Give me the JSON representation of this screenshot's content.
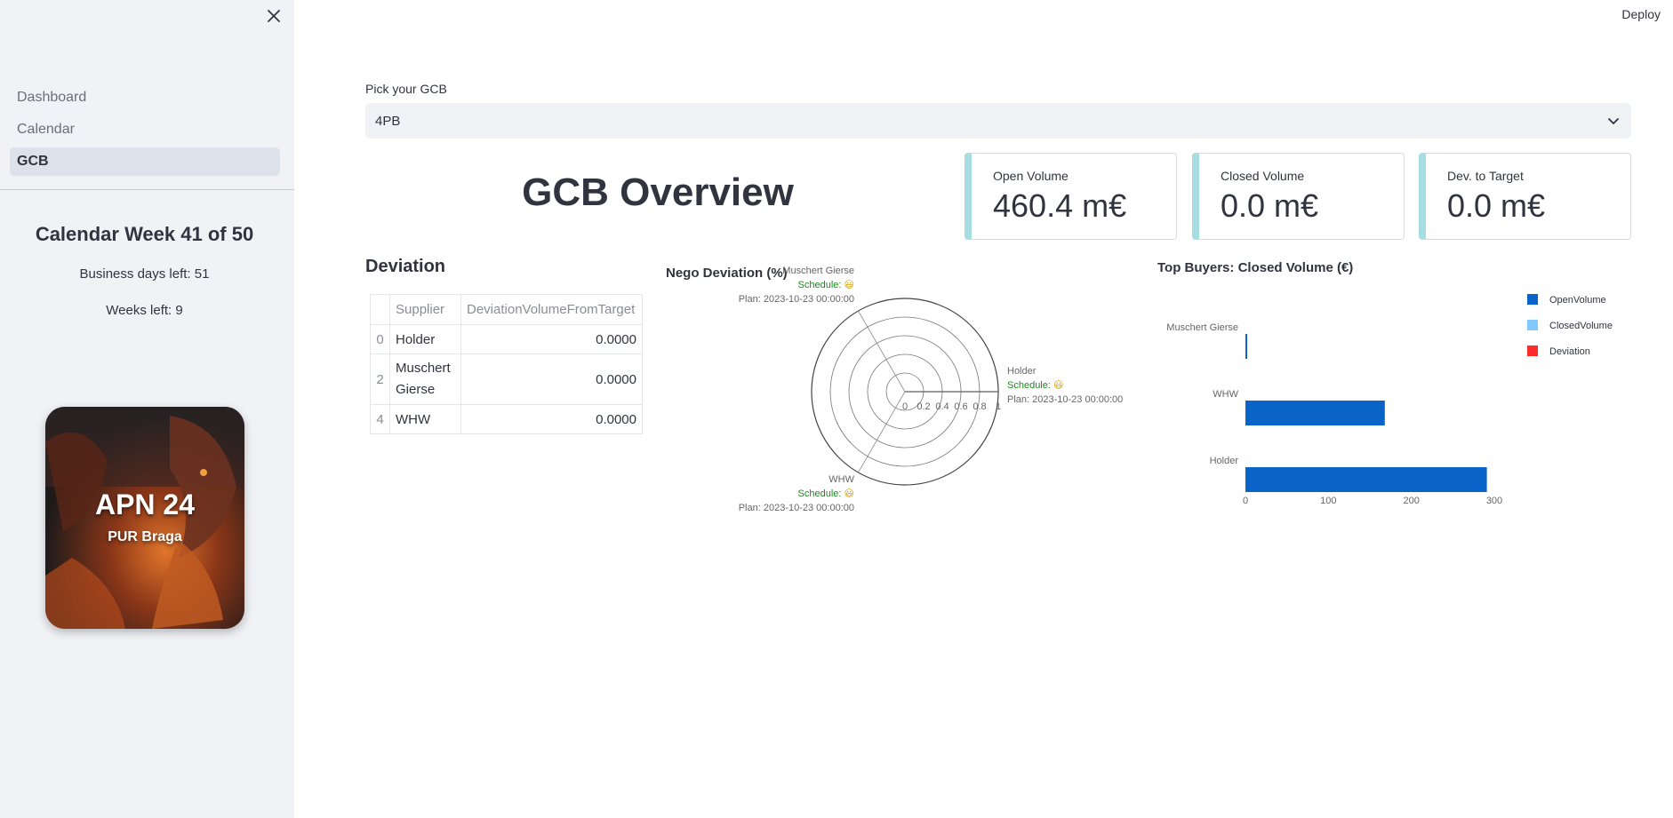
{
  "sidebar": {
    "nav": [
      {
        "label": "Dashboard",
        "active": false
      },
      {
        "label": "Calendar",
        "active": false
      },
      {
        "label": "GCB",
        "active": true
      }
    ],
    "week_title": "Calendar Week 41 of 50",
    "business_days": "Business days left: 51",
    "weeks_left": "Weeks left: 9",
    "card": {
      "title": "APN 24",
      "subtitle": "PUR Braga"
    }
  },
  "header": {
    "deploy_label": "Deploy"
  },
  "selector": {
    "label": "Pick your GCB",
    "value": "4PB"
  },
  "page_title": "GCB Overview",
  "metrics": [
    {
      "label": "Open Volume",
      "value": "460.4 m€"
    },
    {
      "label": "Closed Volume",
      "value": "0.0 m€"
    },
    {
      "label": "Dev. to Target",
      "value": "0.0 m€"
    }
  ],
  "deviation": {
    "title": "Deviation",
    "columns": [
      "",
      "Supplier",
      "DeviationVolumeFromTarget"
    ],
    "rows": [
      {
        "index": "0",
        "supplier": "Holder",
        "value": "0.0000"
      },
      {
        "index": "2",
        "supplier": "Muschert Gierse",
        "value": "0.0000"
      },
      {
        "index": "4",
        "supplier": "WHW",
        "value": "0.0000"
      }
    ]
  },
  "chart_data": [
    {
      "type": "radar",
      "title": "Nego Deviation (%)",
      "radial_ticks": [
        "0",
        "0.2",
        "0.4",
        "0.6",
        "0.8",
        "1"
      ],
      "rlim": [
        0,
        1
      ],
      "categories": [
        {
          "name": "Holder",
          "schedule": "Schedule: ",
          "emoji": "😃",
          "plan": "Plan: 2023-10-23 00:00:00",
          "value": 0
        },
        {
          "name": "Muschert Gierse",
          "schedule": "Schedule: ",
          "emoji": "😃",
          "plan": "Plan: 2023-10-23 00:00:00",
          "value": 0
        },
        {
          "name": "WHW",
          "schedule": "Schedule: ",
          "emoji": "😃",
          "plan": "Plan: 2023-10-23 00:00:00",
          "value": 0
        }
      ],
      "colors": {
        "schedule": "#1a8a1a",
        "grid": "#444444"
      }
    },
    {
      "type": "bar",
      "orientation": "horizontal",
      "title": "Top Buyers: Closed Volume (€)",
      "categories": [
        "Muschert Gierse",
        "WHW",
        "Holder"
      ],
      "series": [
        {
          "name": "OpenVolume",
          "color": "#0a64c8",
          "values": [
            2,
            168,
            291
          ]
        },
        {
          "name": "ClosedVolume",
          "color": "#83c9ff",
          "values": [
            0,
            0,
            0
          ]
        },
        {
          "name": "Deviation",
          "color": "#ff2b2b",
          "values": [
            0,
            0,
            0
          ]
        }
      ],
      "xticks": [
        "0",
        "100",
        "200",
        "300"
      ],
      "xlim": [
        0,
        310
      ],
      "legend": "top-right"
    }
  ]
}
